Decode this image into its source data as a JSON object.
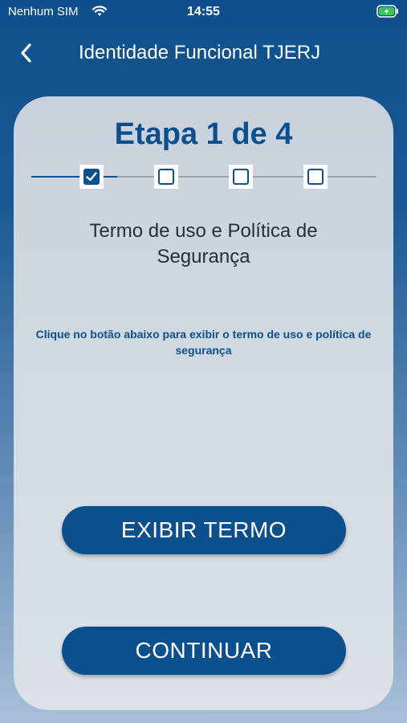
{
  "status_bar": {
    "carrier": "Nenhum SIM",
    "time": "14:55",
    "battery_color": "#34c759"
  },
  "nav": {
    "title": "Identidade Funcional TJERJ"
  },
  "wizard": {
    "step_label": "Etapa 1 de 4",
    "current_step": 1,
    "total_steps": 4,
    "step_title": "Termo de uso e Política de Segurança",
    "hint": "Clique no botão abaixo para exibir o termo de uso e política de segurança"
  },
  "buttons": {
    "show_terms": "EXIBIR TERMO",
    "continue": "CONTINUAR"
  },
  "colors": {
    "brand": "#0c4f8d",
    "card": "#d6dce3"
  }
}
